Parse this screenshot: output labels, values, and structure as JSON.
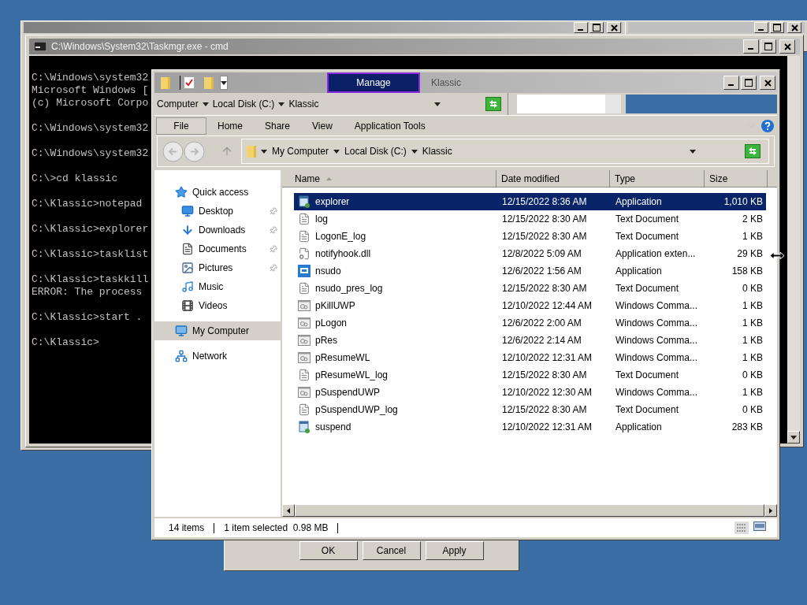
{
  "cmd_window": {
    "title": "C:\\Windows\\System32\\Taskmgr.exe - cmd",
    "blocks": [
      [
        "C:\\Windows\\system32",
        "Microsoft Windows [",
        "(c) Microsoft Corpo"
      ],
      [
        "C:\\Windows\\system32"
      ],
      [
        "C:\\Windows\\system32"
      ],
      [
        "C:\\>cd klassic"
      ],
      [
        "C:\\Klassic>notepad"
      ],
      [
        "C:\\Klassic>explorer"
      ],
      [
        "C:\\Klassic>tasklist"
      ],
      [
        "C:\\Klassic>taskkill",
        "ERROR: The process"
      ],
      [
        "C:\\Klassic>start ."
      ],
      [
        "C:\\Klassic>"
      ]
    ]
  },
  "dialog": {
    "buttons": [
      "OK",
      "Cancel",
      "Apply"
    ]
  },
  "explorer": {
    "context_tab": "Manage",
    "title": "Klassic",
    "breadcrumb": [
      "Computer",
      "Local Disk (C:)",
      "Klassic"
    ],
    "ribbon_tabs": [
      {
        "label": "File",
        "selected": true
      },
      {
        "label": "Home",
        "selected": false
      },
      {
        "label": "Share",
        "selected": false
      },
      {
        "label": "View",
        "selected": false
      },
      {
        "label": "Application Tools",
        "selected": false
      }
    ],
    "address": [
      "My Computer",
      "Local Disk (C:)",
      "Klassic"
    ],
    "nav": [
      {
        "label": "Quick access",
        "kind": "star",
        "pinned": false,
        "selected": false,
        "children": [
          {
            "label": "Desktop",
            "kind": "desktop",
            "pinned": true,
            "selected": false
          },
          {
            "label": "Downloads",
            "kind": "download",
            "pinned": true,
            "selected": false
          },
          {
            "label": "Documents",
            "kind": "documents",
            "pinned": true,
            "selected": false
          },
          {
            "label": "Pictures",
            "kind": "pictures",
            "pinned": true,
            "selected": false
          },
          {
            "label": "Music",
            "kind": "music",
            "pinned": false,
            "selected": false
          },
          {
            "label": "Videos",
            "kind": "videos",
            "pinned": false,
            "selected": false
          }
        ]
      },
      {
        "label": "My Computer",
        "kind": "computer",
        "pinned": false,
        "selected": true
      },
      {
        "label": "Network",
        "kind": "network",
        "pinned": false,
        "selected": false
      }
    ],
    "columns": [
      "Name",
      "Date modified",
      "Type",
      "Size"
    ],
    "rows": [
      {
        "name": "explorer",
        "date": "12/15/2022 8:36 AM",
        "type": "Application",
        "size": "1,010 KB",
        "kind": "app",
        "selected": true
      },
      {
        "name": "log",
        "date": "12/15/2022 8:30 AM",
        "type": "Text Document",
        "size": "2 KB",
        "kind": "text",
        "selected": false
      },
      {
        "name": "LogonE_log",
        "date": "12/15/2022 8:30 AM",
        "type": "Text Document",
        "size": "1 KB",
        "kind": "text",
        "selected": false
      },
      {
        "name": "notifyhook.dll",
        "date": "12/8/2022 5:09 AM",
        "type": "Application exten...",
        "size": "29 KB",
        "kind": "dll",
        "selected": false
      },
      {
        "name": "nsudo",
        "date": "12/6/2022 1:56 AM",
        "type": "Application",
        "size": "158 KB",
        "kind": "tool",
        "selected": false
      },
      {
        "name": "nsudo_pres_log",
        "date": "12/15/2022 8:30 AM",
        "type": "Text Document",
        "size": "0 KB",
        "kind": "text",
        "selected": false
      },
      {
        "name": "pKillUWP",
        "date": "12/10/2022 12:44 AM",
        "type": "Windows Comma...",
        "size": "1 KB",
        "kind": "script",
        "selected": false
      },
      {
        "name": "pLogon",
        "date": "12/6/2022 2:00 AM",
        "type": "Windows Comma...",
        "size": "1 KB",
        "kind": "script",
        "selected": false
      },
      {
        "name": "pRes",
        "date": "12/6/2022 2:14 AM",
        "type": "Windows Comma...",
        "size": "1 KB",
        "kind": "script",
        "selected": false
      },
      {
        "name": "pResumeWL",
        "date": "12/10/2022 12:31 AM",
        "type": "Windows Comma...",
        "size": "1 KB",
        "kind": "script",
        "selected": false
      },
      {
        "name": "pResumeWL_log",
        "date": "12/15/2022 8:30 AM",
        "type": "Text Document",
        "size": "0 KB",
        "kind": "text",
        "selected": false
      },
      {
        "name": "pSuspendUWP",
        "date": "12/10/2022 12:30 AM",
        "type": "Windows Comma...",
        "size": "1 KB",
        "kind": "script",
        "selected": false
      },
      {
        "name": "pSuspendUWP_log",
        "date": "12/15/2022 8:30 AM",
        "type": "Text Document",
        "size": "0 KB",
        "kind": "text",
        "selected": false
      },
      {
        "name": "suspend",
        "date": "12/10/2022 12:31 AM",
        "type": "Application",
        "size": "283 KB",
        "kind": "app",
        "selected": false
      }
    ],
    "status": [
      "14 items",
      "1 item selected  0.98 MB"
    ]
  }
}
